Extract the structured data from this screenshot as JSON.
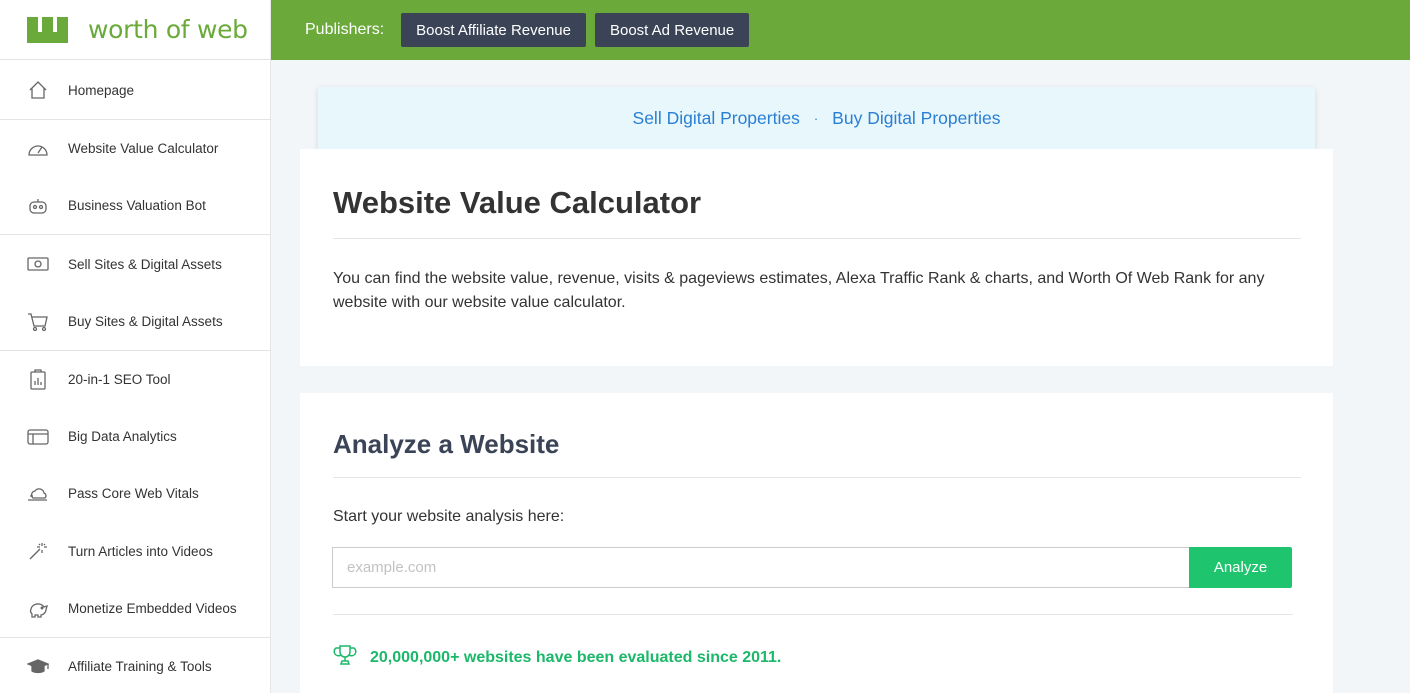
{
  "logo": {
    "text": "worth of web",
    "icon": "logo-mark"
  },
  "topbar": {
    "label": "Publishers:",
    "buttons": [
      "Boost Affiliate Revenue",
      "Boost Ad Revenue"
    ]
  },
  "sidebar": {
    "items": [
      {
        "label": "Homepage",
        "icon": "home-icon"
      },
      {
        "label": "Website Value Calculator",
        "icon": "gauge-icon"
      },
      {
        "label": "Business Valuation Bot",
        "icon": "robot-icon"
      },
      {
        "label": "Sell Sites & Digital Assets",
        "icon": "money-icon"
      },
      {
        "label": "Buy Sites & Digital Assets",
        "icon": "cart-icon"
      },
      {
        "label": "20-in-1 SEO Tool",
        "icon": "clipboard-chart-icon"
      },
      {
        "label": "Big Data Analytics",
        "icon": "browser-window-icon"
      },
      {
        "label": "Pass Core Web Vitals",
        "icon": "speed-cloud-icon"
      },
      {
        "label": "Turn Articles into Videos",
        "icon": "magic-wand-icon"
      },
      {
        "label": "Monetize Embedded Videos",
        "icon": "piggy-bank-icon"
      },
      {
        "label": "Affiliate Training & Tools",
        "icon": "graduation-cap-icon"
      }
    ]
  },
  "banner": {
    "sell": "Sell Digital Properties",
    "separator": "·",
    "buy": "Buy Digital Properties"
  },
  "intro": {
    "title": "Website Value Calculator",
    "description": "You can find the website value, revenue, visits & pageviews estimates, Alexa Traffic Rank & charts, and Worth Of Web Rank for any website with our website value calculator."
  },
  "analyze": {
    "title": "Analyze a Website",
    "prompt": "Start your website analysis here:",
    "placeholder": "example.com",
    "value": "",
    "button": "Analyze",
    "stat": "20,000,000+ websites have been evaluated since 2011.",
    "stat_icon": "trophy-icon"
  },
  "colors": {
    "brand_green": "#6aa93a",
    "button_dark": "#3a4456",
    "accent_green": "#1ec56e",
    "link_blue": "#2a7fd4",
    "banner_bg": "#e8f7fc"
  }
}
